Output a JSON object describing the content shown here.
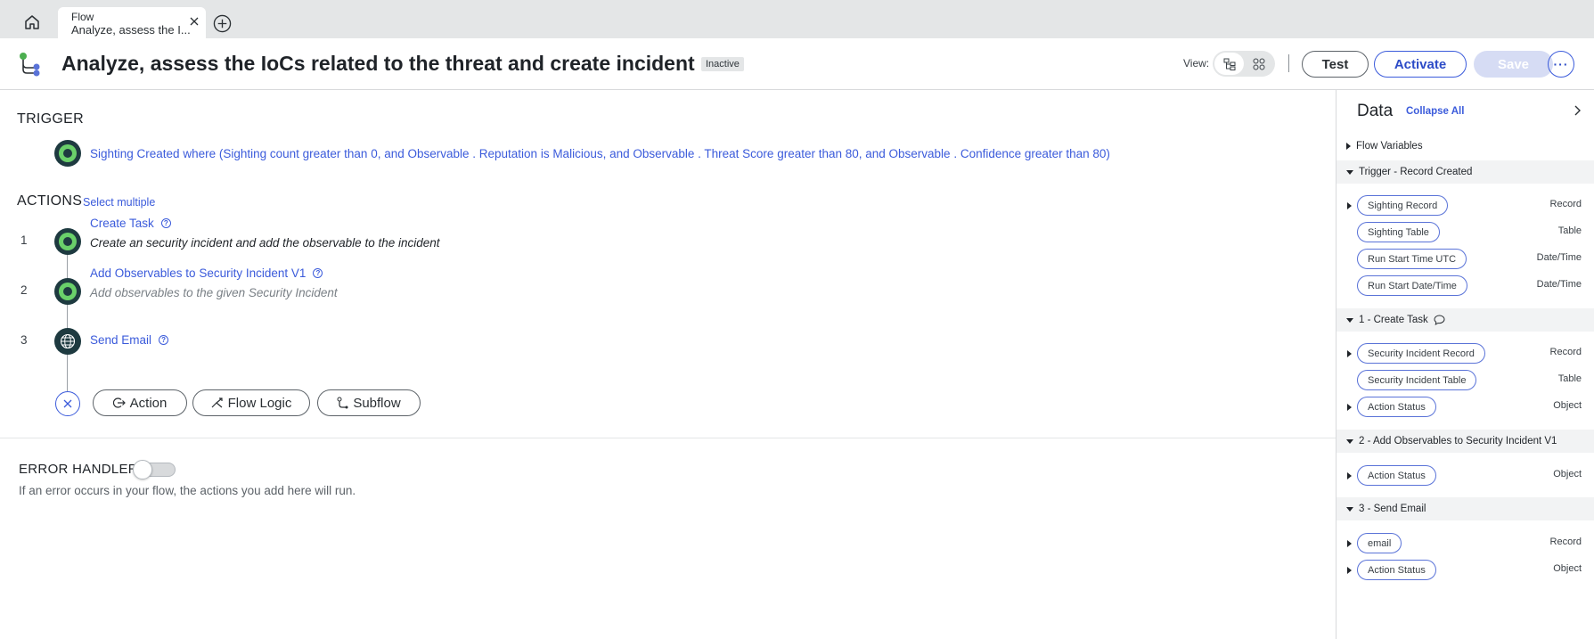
{
  "tabs": {
    "kind": "Flow",
    "title": "Analyze, assess the I..."
  },
  "header": {
    "title": "Analyze, assess the IoCs related to the threat and create incident",
    "status": "Inactive",
    "view_label": "View:",
    "test_label": "Test",
    "activate_label": "Activate",
    "save_label": "Save",
    "more_label": "···"
  },
  "trigger": {
    "heading": "TRIGGER",
    "condition": "Sighting Created where (Sighting count greater than 0, and Observable . Reputation is Malicious, and Observable . Threat Score greater than 80, and Observable . Confidence greater than 80)"
  },
  "actions": {
    "heading": "ACTIONS",
    "select_multiple": "Select multiple",
    "steps": [
      {
        "num": "1",
        "title": "Create Task",
        "desc": "Create an security incident and add the observable to the incident"
      },
      {
        "num": "2",
        "title": "Add Observables to Security Incident V1",
        "desc": "Add observables to the given Security Incident"
      },
      {
        "num": "3",
        "title": "Send Email",
        "desc": ""
      }
    ],
    "add_action": "Action",
    "add_flow_logic": "Flow Logic",
    "add_subflow": "Subflow"
  },
  "error_handler": {
    "heading": "ERROR HANDLER",
    "enabled": false,
    "desc": "If an error occurs in your flow, the actions you add here will run."
  },
  "data_panel": {
    "title": "Data",
    "collapse_all": "Collapse All",
    "flow_variables": "Flow Variables",
    "groups": [
      {
        "label": "Trigger - Record Created",
        "items": [
          {
            "name": "Sighting Record",
            "type": "Record",
            "expandable": true
          },
          {
            "name": "Sighting Table",
            "type": "Table",
            "expandable": false
          },
          {
            "name": "Run Start Time UTC",
            "type": "Date/Time",
            "expandable": false
          },
          {
            "name": "Run Start Date/Time",
            "type": "Date/Time",
            "expandable": false
          }
        ]
      },
      {
        "label": "1 - Create Task",
        "items": [
          {
            "name": "Security Incident Record",
            "type": "Record",
            "expandable": true
          },
          {
            "name": "Security Incident Table",
            "type": "Table",
            "expandable": false
          },
          {
            "name": "Action Status",
            "type": "Object",
            "expandable": true
          }
        ]
      },
      {
        "label": "2 - Add Observables to Security Incident V1",
        "items": [
          {
            "name": "Action Status",
            "type": "Object",
            "expandable": true
          }
        ]
      },
      {
        "label": "3 - Send Email",
        "items": [
          {
            "name": "email",
            "type": "Record",
            "expandable": true
          },
          {
            "name": "Action Status",
            "type": "Object",
            "expandable": true
          }
        ]
      }
    ]
  },
  "colors": {
    "accent": "#3b5bdb",
    "node_bg": "#1e3a40",
    "node_ring": "#6ad06a",
    "save_disabled": "#d6dcf4"
  }
}
